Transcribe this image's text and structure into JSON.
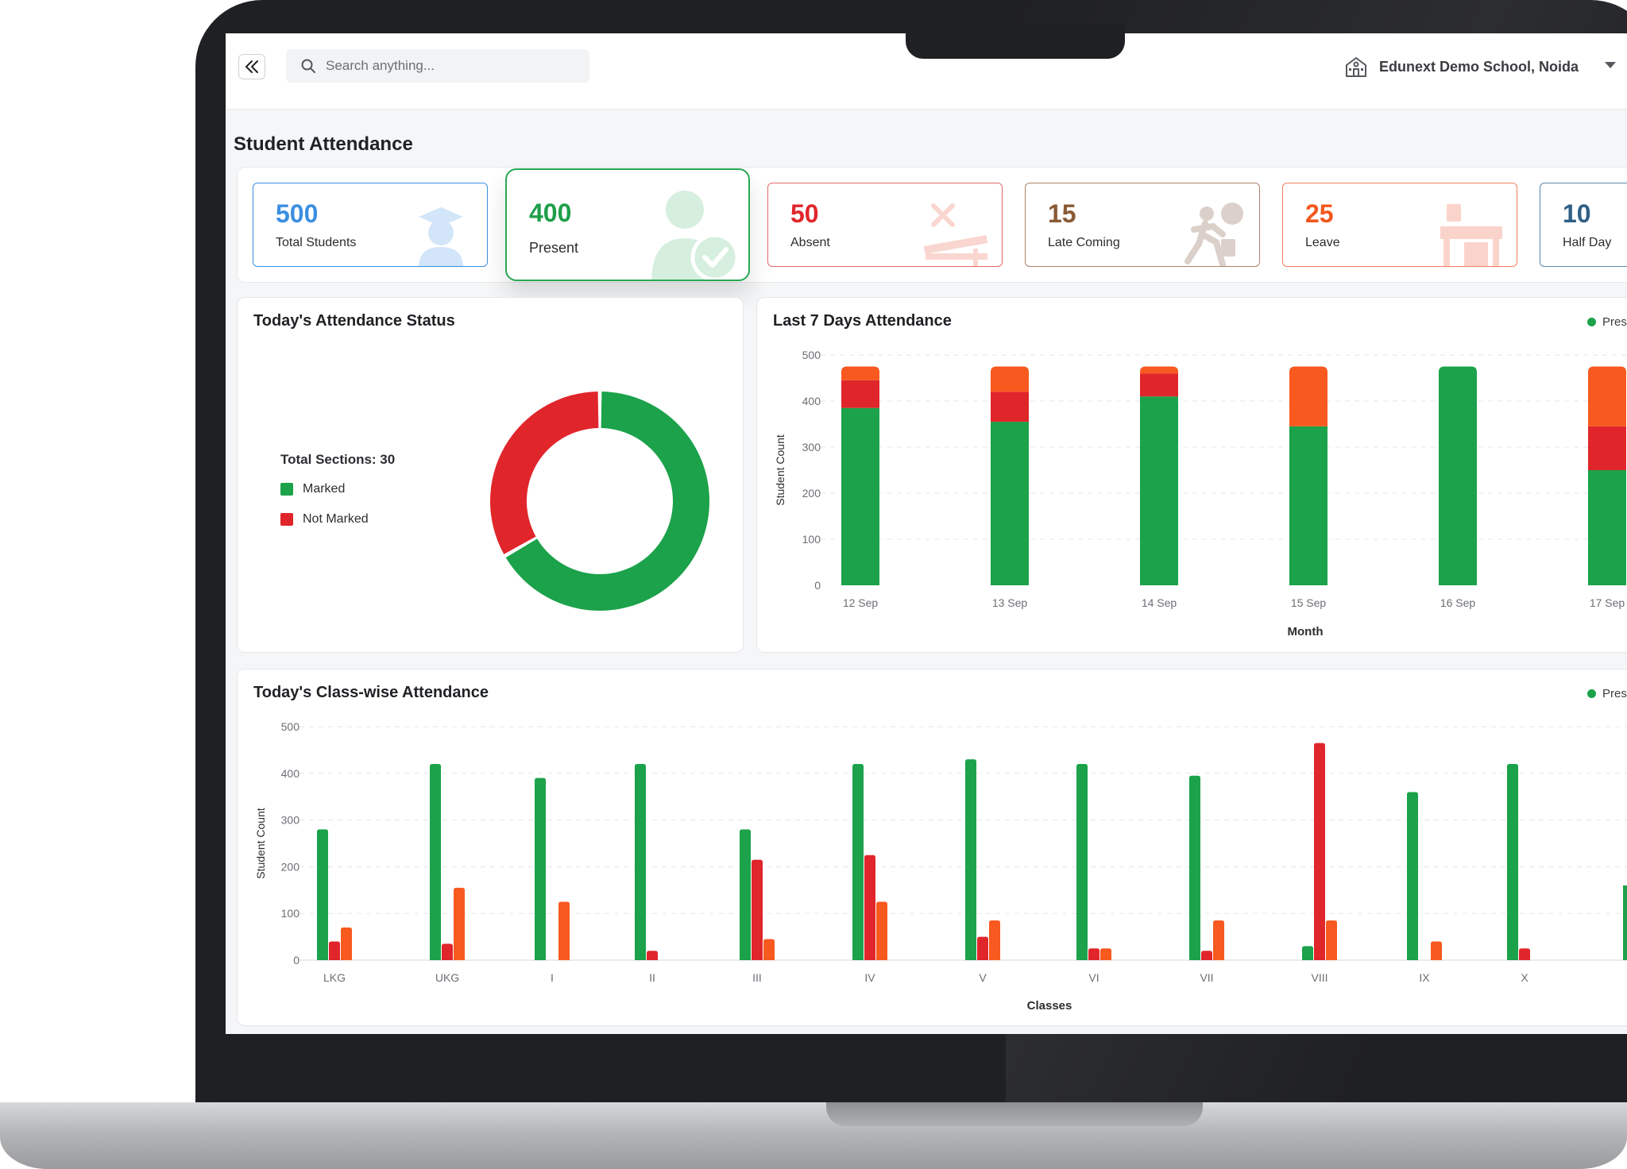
{
  "header": {
    "search_placeholder": "Search anything...",
    "school_name": "Edunext Demo School, Noida"
  },
  "page": {
    "title": "Student Attendance"
  },
  "stats": [
    {
      "value": "500",
      "label": "Total Students",
      "color": "#3b8fe0"
    },
    {
      "value": "400",
      "label": "Present",
      "color": "#1e9e4a"
    },
    {
      "value": "50",
      "label": "Absent",
      "color": "#e0262b"
    },
    {
      "value": "15",
      "label": "Late Coming",
      "color": "#8a5a34"
    },
    {
      "value": "25",
      "label": "Leave",
      "color": "#f2571f"
    },
    {
      "value": "10",
      "label": "Half Day",
      "color": "#2f5f86"
    }
  ],
  "colors": {
    "present": "#1ba24a",
    "absent": "#e0262b",
    "leave": "#f7591f"
  },
  "status_panel": {
    "title": "Today's Attendance Status",
    "total_sections": "Total Sections: 30",
    "legend": [
      "Marked",
      "Not Marked"
    ]
  },
  "weekly_panel": {
    "title": "Last 7 Days Attendance",
    "legend_visible": "Pres"
  },
  "class_panel": {
    "title": "Today's Class-wise Attendance",
    "legend_visible": "Pres"
  },
  "chart_data": [
    {
      "type": "pie",
      "title": "Today's Attendance Status",
      "categories": [
        "Marked",
        "Not Marked"
      ],
      "values": [
        20,
        10
      ]
    },
    {
      "type": "bar",
      "stacked": true,
      "title": "Last 7 Days Attendance",
      "xlabel": "Month",
      "ylabel": "Student Count",
      "ylim": [
        0,
        500
      ],
      "yticks": [
        0,
        100,
        200,
        300,
        400,
        500
      ],
      "categories": [
        "12 Sep",
        "13 Sep",
        "14 Sep",
        "15 Sep",
        "16 Sep",
        "17 Sep"
      ],
      "series": [
        {
          "name": "Present",
          "values": [
            385,
            355,
            410,
            345,
            475,
            250
          ]
        },
        {
          "name": "Absent",
          "values": [
            60,
            65,
            50,
            0,
            0,
            95
          ]
        },
        {
          "name": "Leave",
          "values": [
            30,
            55,
            15,
            130,
            0,
            130
          ]
        }
      ]
    },
    {
      "type": "bar",
      "title": "Today's Class-wise Attendance",
      "xlabel": "Classes",
      "ylabel": "Student Count",
      "ylim": [
        0,
        500
      ],
      "yticks": [
        0,
        100,
        200,
        300,
        400,
        500
      ],
      "categories": [
        "LKG",
        "UKG",
        "I",
        "II",
        "III",
        "IV",
        "V",
        "VI",
        "VII",
        "VIII",
        "IX",
        "X"
      ],
      "series": [
        {
          "name": "Present",
          "values": [
            280,
            420,
            390,
            420,
            280,
            420,
            430,
            420,
            395,
            30,
            360,
            420
          ]
        },
        {
          "name": "Absent",
          "values": [
            40,
            35,
            0,
            20,
            215,
            225,
            50,
            25,
            20,
            465,
            0,
            25
          ]
        },
        {
          "name": "Leave",
          "values": [
            70,
            155,
            125,
            0,
            45,
            125,
            85,
            25,
            85,
            85,
            40,
            0
          ]
        }
      ]
    }
  ]
}
